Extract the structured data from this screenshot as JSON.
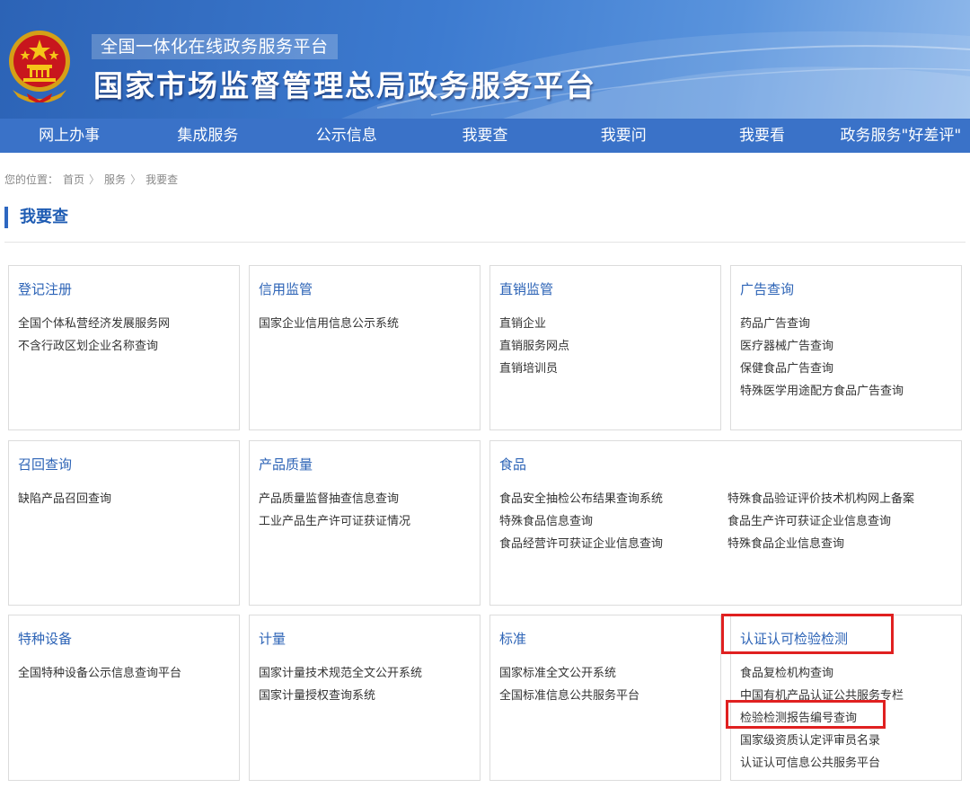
{
  "header": {
    "subtitle": "全国一体化在线政务服务平台",
    "title": "国家市场监督管理总局政务服务平台"
  },
  "nav": [
    "网上办事",
    "集成服务",
    "公示信息",
    "我要查",
    "我要问",
    "我要看",
    "政务服务\"好差评\""
  ],
  "breadcrumb": {
    "prefix": "您的位置：",
    "items": [
      "首页",
      "服务",
      "我要查"
    ],
    "separator": "〉"
  },
  "section_title": "我要查",
  "cards": [
    {
      "title": "登记注册",
      "items": [
        "全国个体私营经济发展服务网",
        "不含行政区划企业名称查询"
      ]
    },
    {
      "title": "信用监管",
      "items": [
        "国家企业信用信息公示系统"
      ]
    },
    {
      "title": "直销监管",
      "items": [
        "直销企业",
        "直销服务网点",
        "直销培训员"
      ]
    },
    {
      "title": "广告查询",
      "items": [
        "药品广告查询",
        "医疗器械广告查询",
        "保健食品广告查询",
        "特殊医学用途配方食品广告查询"
      ]
    },
    {
      "title": "召回查询",
      "items": [
        "缺陷产品召回查询"
      ]
    },
    {
      "title": "产品质量",
      "items": [
        "产品质量监督抽查信息查询",
        "工业产品生产许可证获证情况"
      ]
    },
    {
      "title": "食品",
      "items": [
        "食品安全抽检公布结果查询系统",
        "特殊食品信息查询",
        "食品经营许可获证企业信息查询"
      ],
      "items2": [
        "特殊食品验证评价技术机构网上备案",
        "食品生产许可获证企业信息查询",
        "特殊食品企业信息查询"
      ]
    },
    {
      "title": "特种设备",
      "items": [
        "全国特种设备公示信息查询平台"
      ]
    },
    {
      "title": "计量",
      "items": [
        "国家计量技术规范全文公开系统",
        "国家计量授权查询系统"
      ]
    },
    {
      "title": "标准",
      "items": [
        "国家标准全文公开系统",
        "全国标准信息公共服务平台"
      ]
    },
    {
      "title": "认证认可检验检测",
      "items": [
        "食品复检机构查询",
        "中国有机产品认证公共服务专栏",
        "检验检测报告编号查询",
        "国家级资质认定评审员名录",
        "认证认可信息公共服务平台"
      ]
    }
  ],
  "colors": {
    "banner": "#3d7bd0",
    "nav": "#3a72c8",
    "link": "#2c63b6",
    "highlight": "#e02020"
  }
}
